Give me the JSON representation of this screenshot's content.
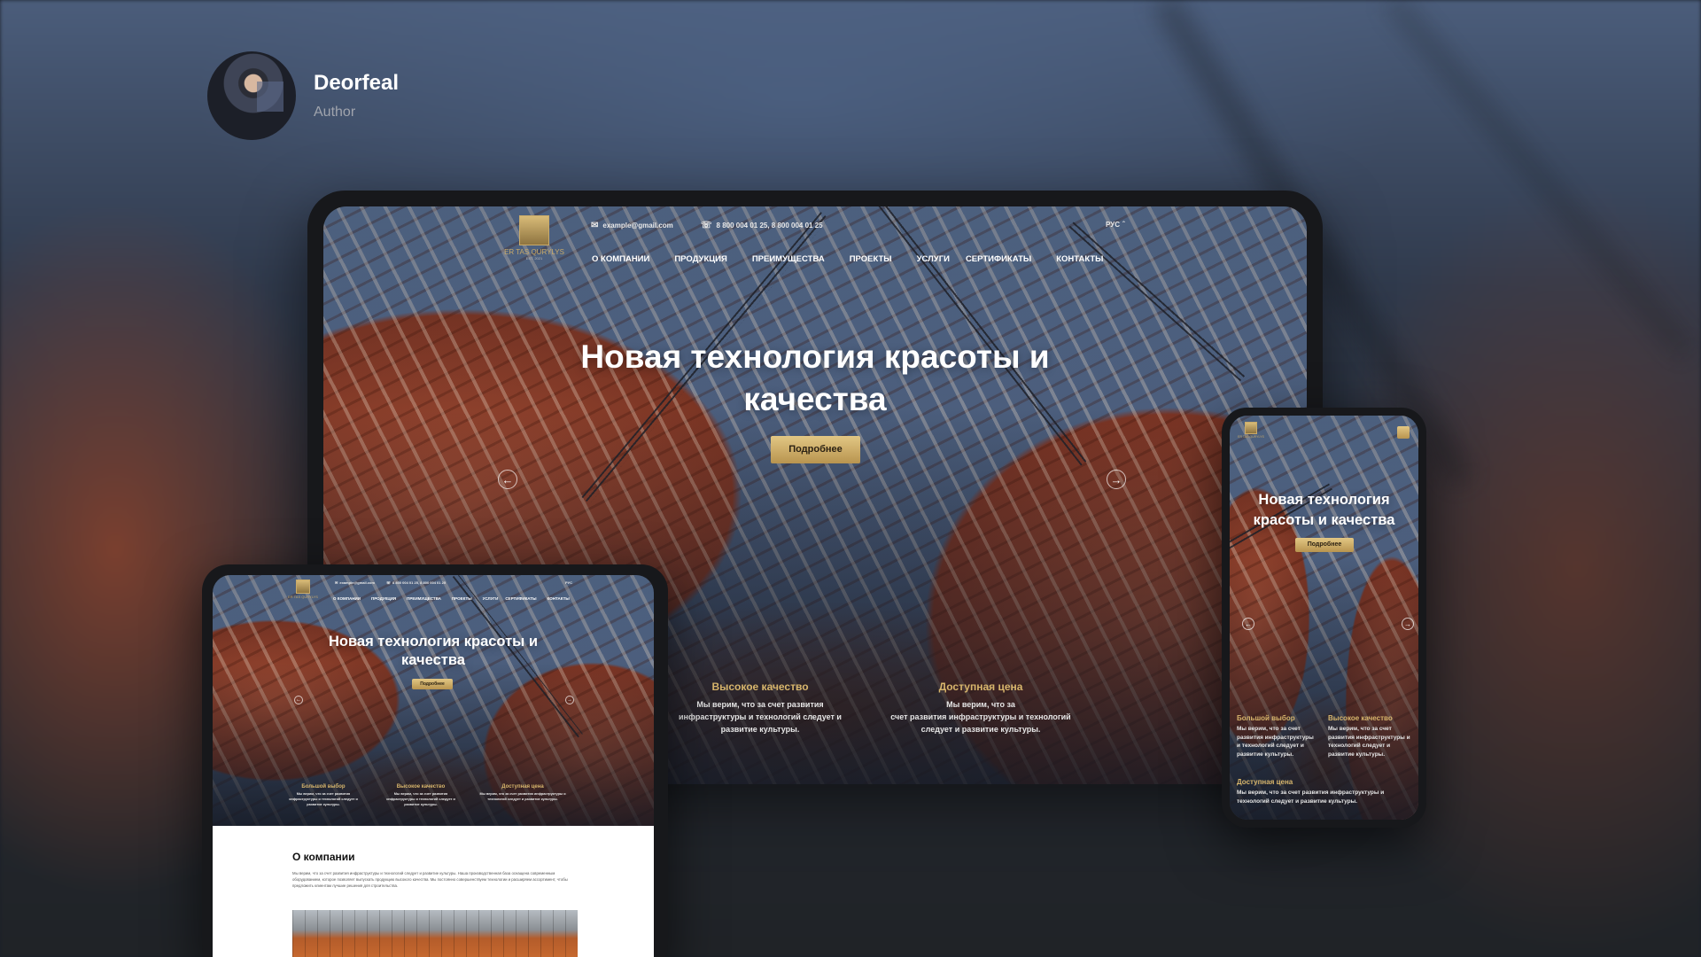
{
  "author": {
    "name": "Deorfeal",
    "role": "Author"
  },
  "site": {
    "logo_text": "ER TAS QURYLYS",
    "logo_sub": "EST. 2021",
    "email": "example@gmail.com",
    "phone": "8 800 004 01 25, 8 800 004 01 25",
    "language": "РУС",
    "nav": [
      "О КОМПАНИИ",
      "ПРОДУКЦИЯ",
      "ПРЕИМУЩЕСТВА",
      "ПРОЕКТЫ",
      "УСЛУГИ",
      "СЕРТИФИКАТЫ",
      "КОНТАКТЫ"
    ],
    "hero_title": "Новая технология красоты и качества",
    "hero_button": "Подробнее",
    "features": [
      {
        "title": "Большой выбор",
        "text": "Мы верим, что за счет развития инфраструктуры и технологий следует и развитие культуры."
      },
      {
        "title": "Высокое качество",
        "text": "Мы верим, что за счет развития инфраструктуры и технологий следует и развитие культуры."
      },
      {
        "title": "Доступная цена",
        "text": "Мы верим, что за счет развития инфраструктуры и технологий следует и развитие культуры."
      }
    ],
    "laptop_feature_partial": "ры.",
    "laptop_features": [
      {
        "title": "Высокое качество",
        "l1": "Мы верим, что за счет развития",
        "l2": "инфраструктуры и технологий следует и",
        "l3": "развитие культуры."
      },
      {
        "title": "Доступная цена",
        "l1": "Мы верим, что за",
        "l2": "счет развития инфраструктуры и технологий",
        "l3": "следует и развитие культуры."
      }
    ],
    "about_title": "О компании",
    "about_text": "Мы верим, что за счет развития инфраструктуры и технологий следует и развитие культуры. Наша производственная база оснащена современным оборудованием, которое позволяет выпускать продукцию высокого качества. Мы постоянно совершенствуем технологии и расширяем ассортимент, чтобы предложить клиентам лучшие решения для строительства."
  },
  "colors": {
    "accent": "#d8b66c",
    "button": "#c9a862",
    "frame": "#17181b"
  }
}
